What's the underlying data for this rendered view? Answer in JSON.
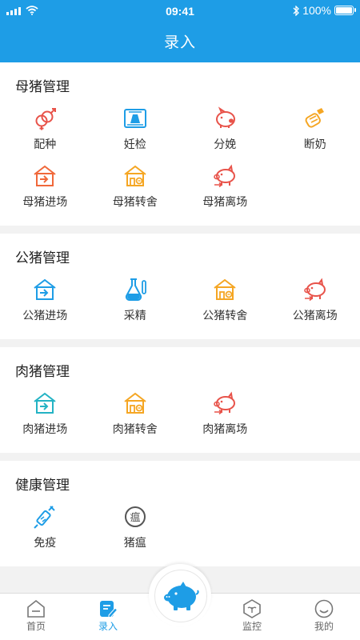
{
  "status": {
    "time": "09:41",
    "battery": "100%"
  },
  "header": {
    "title": "录入"
  },
  "sections": [
    {
      "title": "母猪管理",
      "items": [
        {
          "label": "配种",
          "icon": "gender-icon"
        },
        {
          "label": "妊检",
          "icon": "ultrasound-icon"
        },
        {
          "label": "分娩",
          "icon": "piggy-icon"
        },
        {
          "label": "断奶",
          "icon": "bottle-icon"
        },
        {
          "label": "母猪进场",
          "icon": "house-in-icon"
        },
        {
          "label": "母猪转舍",
          "icon": "house-transfer-icon"
        },
        {
          "label": "母猪离场",
          "icon": "pig-out-icon"
        }
      ]
    },
    {
      "title": "公猪管理",
      "items": [
        {
          "label": "公猪进场",
          "icon": "house-in-icon"
        },
        {
          "label": "采精",
          "icon": "flask-icon"
        },
        {
          "label": "公猪转舍",
          "icon": "house-transfer-icon"
        },
        {
          "label": "公猪离场",
          "icon": "pig-out-icon"
        }
      ]
    },
    {
      "title": "肉猪管理",
      "items": [
        {
          "label": "肉猪进场",
          "icon": "house-in-icon"
        },
        {
          "label": "肉猪转舍",
          "icon": "house-transfer-icon"
        },
        {
          "label": "肉猪离场",
          "icon": "pig-out-icon"
        }
      ]
    },
    {
      "title": "健康管理",
      "items": [
        {
          "label": "免疫",
          "icon": "syringe-icon"
        },
        {
          "label": "猪瘟",
          "icon": "disease-icon"
        }
      ]
    }
  ],
  "tabs": [
    {
      "label": "首页",
      "icon": "home-icon"
    },
    {
      "label": "录入",
      "icon": "edit-icon",
      "active": true
    },
    {
      "label": "",
      "icon": ""
    },
    {
      "label": "监控",
      "icon": "monitor-icon"
    },
    {
      "label": "我的",
      "icon": "smile-icon"
    }
  ],
  "colors": {
    "primary": "#1e9de6",
    "red": "#e8534a",
    "orange": "#f5a623",
    "teal": "#23b3c4"
  }
}
